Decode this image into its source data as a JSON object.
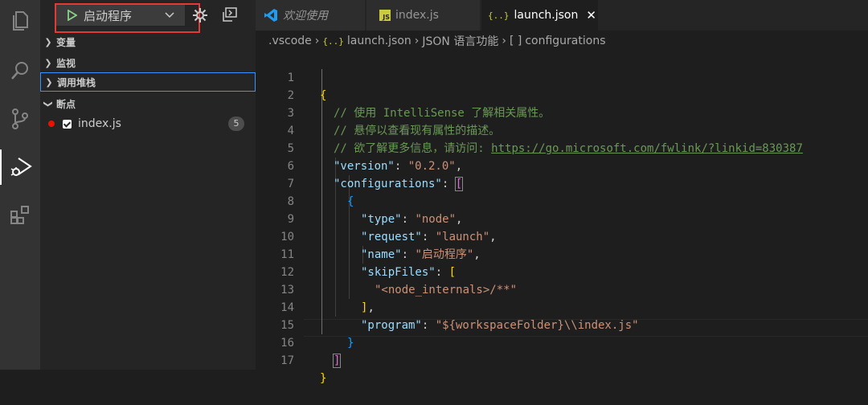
{
  "debug": {
    "config_name": "启动程序",
    "sections": {
      "variables": "变量",
      "watch": "监视",
      "callstack": "调用堆栈",
      "breakpoints": "断点"
    },
    "breakpoint": {
      "file": "index.js",
      "count": "5"
    }
  },
  "tabs": [
    {
      "label": "欢迎使用"
    },
    {
      "label": "index.js"
    },
    {
      "label": "launch.json"
    }
  ],
  "breadcrumb": {
    "folder": ".vscode",
    "file": "launch.json",
    "section": "JSON 语言功能",
    "symbol": "configurations"
  },
  "code": {
    "line_numbers": [
      "1",
      "2",
      "3",
      "4",
      "5",
      "6",
      "7",
      "8",
      "9",
      "10",
      "11",
      "12",
      "13",
      "14",
      "15",
      "16",
      "17"
    ],
    "comment1": "// 使用 IntelliSense 了解相关属性。",
    "comment2": "// 悬停以查看现有属性的描述。",
    "comment3_prefix": "// 欲了解更多信息，请访问: ",
    "comment3_link": "https://go.microsoft.com/fwlink/?linkid=830387",
    "version_key": "\"version\"",
    "version_val": "\"0.2.0\"",
    "configs_key": "\"configurations\"",
    "type_key": "\"type\"",
    "type_val": "\"node\"",
    "request_key": "\"request\"",
    "request_val": "\"launch\"",
    "name_key": "\"name\"",
    "name_val": "\"启动程序\"",
    "skip_key": "\"skipFiles\"",
    "skip_item": "\"<node_internals>/**\"",
    "program_key": "\"program\"",
    "program_val": "\"${workspaceFolder}\\\\index.js\""
  },
  "colors": {
    "accent": "#007acc",
    "highlight_border": "#e53935",
    "breakpoint": "#e51400"
  }
}
